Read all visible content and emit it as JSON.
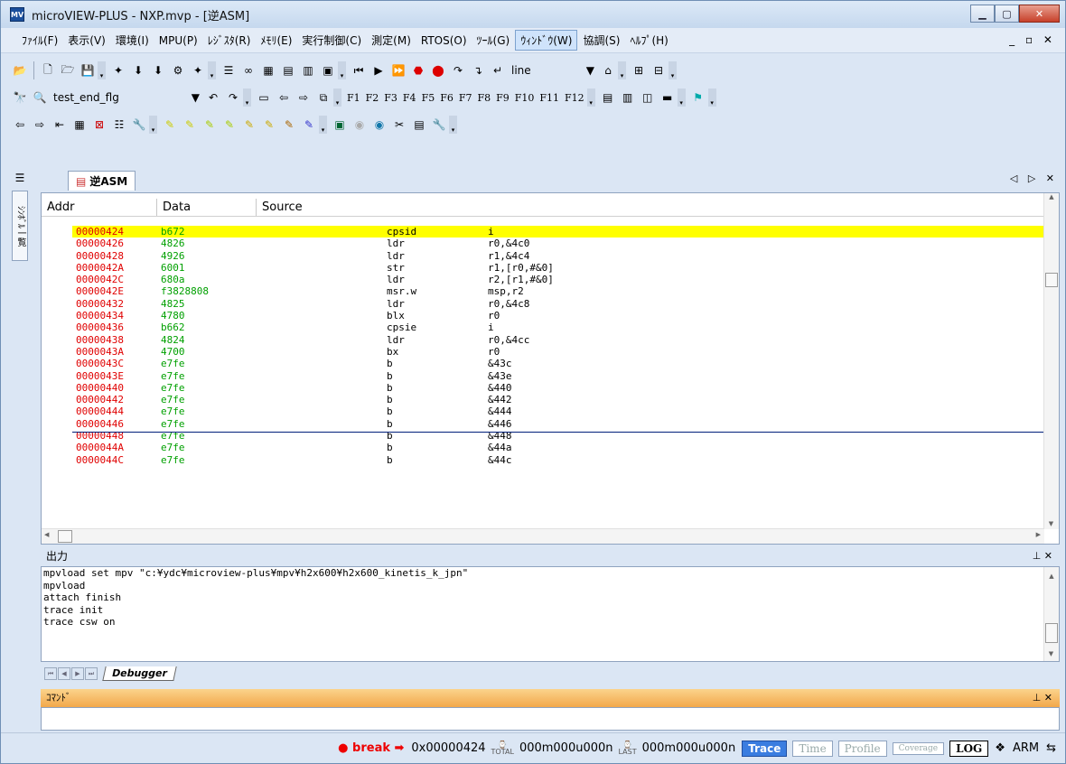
{
  "window": {
    "title": "microVIEW-PLUS - NXP.mvp - [逆ASM]",
    "app_icon": "MV"
  },
  "menu": [
    "ﾌｧｲﾙ(F)",
    "表示(V)",
    "環境(I)",
    "MPU(P)",
    "ﾚｼﾞｽﾀ(R)",
    "ﾒﾓﾘ(E)",
    "実行制御(C)",
    "測定(M)",
    "RTOS(O)",
    "ﾂｰﾙ(G)",
    "ｳｨﾝﾄﾞｳ(W)",
    "協調(S)",
    "ﾍﾙﾌﾟ(H)"
  ],
  "menu_active": "ｳｨﾝﾄﾞｳ(W)",
  "toolbar": {
    "line_combo": "line",
    "symbol_combo": "test_end_flg",
    "fkeys": [
      "F1",
      "F2",
      "F3",
      "F4",
      "F5",
      "F6",
      "F7",
      "F8",
      "F9",
      "F10",
      "F11",
      "F12"
    ]
  },
  "left_panel_tab": "ｼﾝﾎﾞﾙ一覧",
  "doc_tab": "逆ASM",
  "asm": {
    "columns": [
      "Addr",
      "Data",
      "Source"
    ],
    "rows": [
      {
        "addr": "00000424",
        "data": "b672",
        "mn": "cpsid",
        "op": "i"
      },
      {
        "addr": "00000426",
        "data": "4826",
        "mn": "ldr",
        "op": "r0,&4c0"
      },
      {
        "addr": "00000428",
        "data": "4926",
        "mn": "ldr",
        "op": "r1,&4c4"
      },
      {
        "addr": "0000042A",
        "data": "6001",
        "mn": "str",
        "op": "r1,[r0,#&0]"
      },
      {
        "addr": "0000042C",
        "data": "680a",
        "mn": "ldr",
        "op": "r2,[r1,#&0]"
      },
      {
        "addr": "0000042E",
        "data": "f3828808",
        "mn": "msr.w",
        "op": "msp,r2"
      },
      {
        "addr": "00000432",
        "data": "4825",
        "mn": "ldr",
        "op": "r0,&4c8"
      },
      {
        "addr": "00000434",
        "data": "4780",
        "mn": "blx",
        "op": "r0"
      },
      {
        "addr": "00000436",
        "data": "b662",
        "mn": "cpsie",
        "op": "i"
      },
      {
        "addr": "00000438",
        "data": "4824",
        "mn": "ldr",
        "op": "r0,&4cc"
      },
      {
        "addr": "0000043A",
        "data": "4700",
        "mn": "bx",
        "op": "r0"
      },
      {
        "addr": "0000043C",
        "data": "e7fe",
        "mn": "b",
        "op": "&43c"
      },
      {
        "addr": "0000043E",
        "data": "e7fe",
        "mn": "b",
        "op": "&43e"
      },
      {
        "addr": "00000440",
        "data": "e7fe",
        "mn": "b",
        "op": "&440"
      },
      {
        "addr": "00000442",
        "data": "e7fe",
        "mn": "b",
        "op": "&442"
      },
      {
        "addr": "00000444",
        "data": "e7fe",
        "mn": "b",
        "op": "&444"
      },
      {
        "addr": "00000446",
        "data": "e7fe",
        "mn": "b",
        "op": "&446"
      },
      {
        "addr": "00000448",
        "data": "e7fe",
        "mn": "b",
        "op": "&448"
      },
      {
        "addr": "0000044A",
        "data": "e7fe",
        "mn": "b",
        "op": "&44a"
      },
      {
        "addr": "0000044C",
        "data": "e7fe",
        "mn": "b",
        "op": "&44c"
      }
    ]
  },
  "output": {
    "title": "出力",
    "lines": [
      "mpvload set mpv \"c:¥ydc¥microview-plus¥mpv¥h2x600¥h2x600_kinetis_k_jpn\"",
      "mpvload",
      "attach finish",
      "trace init",
      "trace csw on"
    ],
    "tab": "Debugger"
  },
  "command": {
    "title": "ｺﾏﾝﾄﾞ"
  },
  "status": {
    "break": "break",
    "pc": "0x00000424",
    "total_label": "TOTAL",
    "total_time": "000m000u000n",
    "last_label": "LAST",
    "last_time": "000m000u000n",
    "buttons": [
      "Trace",
      "Time",
      "Profile",
      "Coverage",
      "LOG"
    ],
    "cpu": "ARM"
  }
}
